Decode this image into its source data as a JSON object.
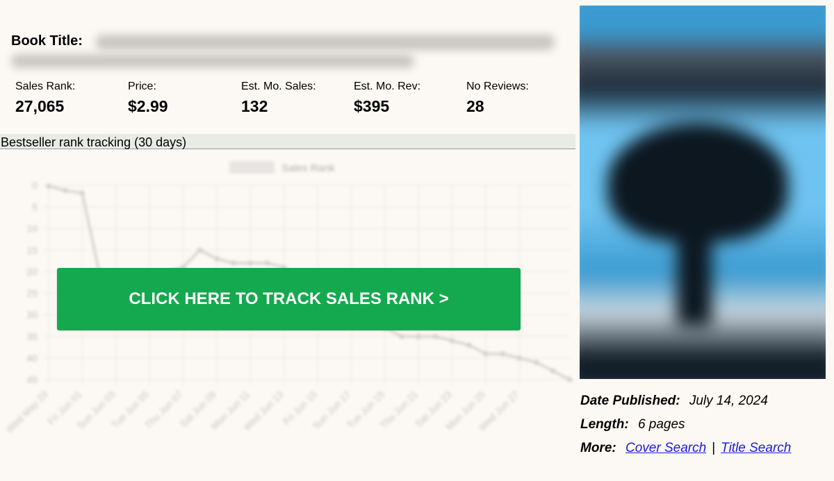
{
  "book": {
    "title_label": "Book Title:"
  },
  "stats": [
    {
      "label": "Sales Rank:",
      "value": "27,065"
    },
    {
      "label": "Price:",
      "value": "$2.99"
    },
    {
      "label": "Est. Mo. Sales:",
      "value": "132"
    },
    {
      "label": "Est. Mo. Rev:",
      "value": "$395"
    },
    {
      "label": "No Reviews:",
      "value": "28"
    }
  ],
  "tracking": {
    "header": "Bestseller rank tracking (30 days)"
  },
  "cta": {
    "label": "CLICK HERE TO TRACK SALES RANK >",
    "color": "#14a94e"
  },
  "chart_data": {
    "type": "line",
    "series": [
      {
        "name": "Sales Rank",
        "x": [
          "Wed May 29",
          "Thu May 30",
          "Fri May 31",
          "Sat Jun 01",
          "Sun Jun 02",
          "Mon Jun 03",
          "Tue Jun 04",
          "Wed Jun 05",
          "Thu Jun 06",
          "Fri Jun 07",
          "Sat Jun 08",
          "Sun Jun 09",
          "Mon Jun 10",
          "Tue Jun 11",
          "Wed Jun 12",
          "Thu Jun 13",
          "Fri Jun 14",
          "Sat Jun 15",
          "Sun Jun 16",
          "Mon Jun 17",
          "Tue Jun 18",
          "Wed Jun 19",
          "Thu Jun 20",
          "Fri Jun 21",
          "Sat Jun 22",
          "Sun Jun 23",
          "Mon Jun 24",
          "Tue Jun 25",
          "Wed Jun 26",
          "Thu Jun 27",
          "Fri Jun 28",
          "Sat Jun 29"
        ],
        "values": [
          0.2,
          1.2,
          1.8,
          20,
          24,
          24,
          23,
          20,
          19,
          15,
          17,
          18,
          18,
          18,
          19,
          22,
          24,
          26,
          28,
          31,
          33,
          35,
          35,
          35,
          36,
          37,
          39,
          39,
          40,
          41,
          43,
          45
        ]
      }
    ],
    "x_tick_labels": [
      "Wed May 29",
      "Fri Jun 01",
      "Sun Jun 03",
      "Tue Jun 05",
      "Thu Jun 07",
      "Sat Jun 09",
      "Mon Jun 11",
      "Wed Jun 13",
      "Fri Jun 15",
      "Sun Jun 17",
      "Tue Jun 19",
      "Thu Jun 21",
      "Sat Jun 23",
      "Mon Jun 25",
      "Wed Jun 27"
    ],
    "y_ticks": [
      0,
      5,
      10,
      15,
      20,
      25,
      30,
      35,
      40,
      45
    ],
    "ylim": [
      0,
      45
    ],
    "y_reversed": true,
    "grid": true,
    "legend": "top-center",
    "color": "#9a9a9a"
  },
  "cover": {
    "colors": [
      "#3a9ad0",
      "#1b2a38",
      "#6ec3f0",
      "#0c1720",
      "#4b5560"
    ]
  },
  "meta": {
    "published_key": "Date Published:",
    "published_val": "July 14, 2024",
    "length_key": "Length:",
    "length_val": "6 pages",
    "more_key": "More:",
    "cover_search": "Cover Search",
    "separator": "|",
    "title_search": "Title Search"
  }
}
